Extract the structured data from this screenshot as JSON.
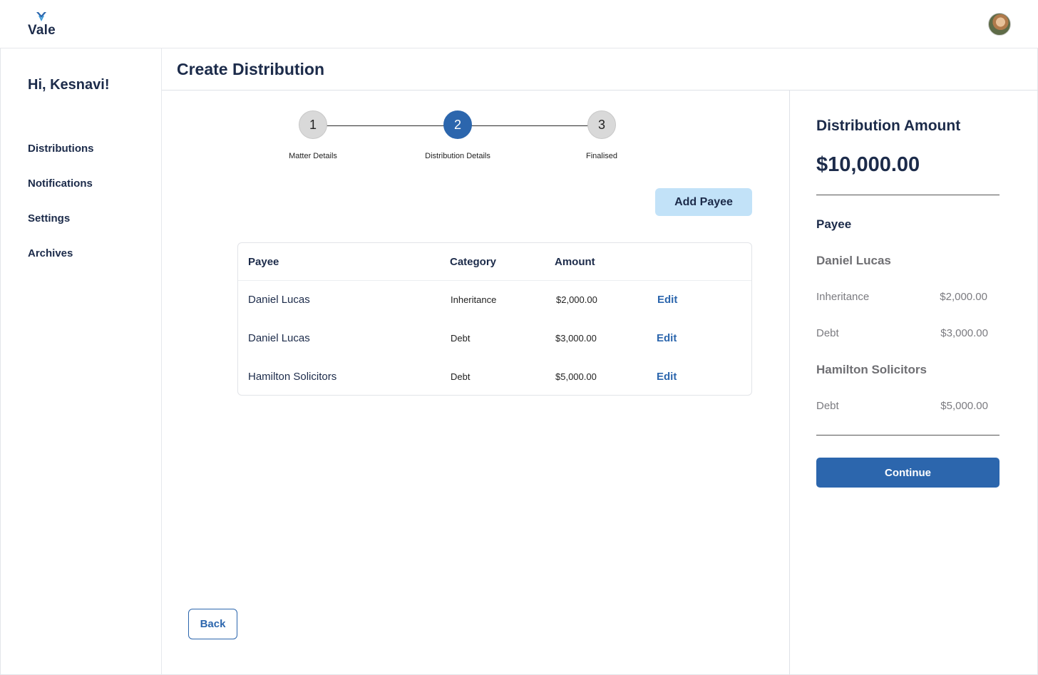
{
  "app": {
    "logo_text": "Vale"
  },
  "sidebar": {
    "greeting": "Hi, Kesnavi!",
    "items": [
      {
        "label": "Distributions"
      },
      {
        "label": "Notifications"
      },
      {
        "label": "Settings"
      },
      {
        "label": "Archives"
      }
    ]
  },
  "page": {
    "title": "Create Distribution"
  },
  "stepper": {
    "steps": [
      {
        "number": "1",
        "label": "Matter Details"
      },
      {
        "number": "2",
        "label": "Distribution Details"
      },
      {
        "number": "3",
        "label": "Finalised"
      }
    ],
    "active_step": 2
  },
  "actions": {
    "add_payee": "Add Payee",
    "back": "Back",
    "continue": "Continue"
  },
  "table": {
    "headers": {
      "payee": "Payee",
      "category": "Category",
      "amount": "Amount"
    },
    "rows": [
      {
        "payee": "Daniel Lucas",
        "category": "Inheritance",
        "amount": "$2,000.00",
        "action": "Edit"
      },
      {
        "payee": "Daniel Lucas",
        "category": "Debt",
        "amount": "$3,000.00",
        "action": "Edit"
      },
      {
        "payee": "Hamilton Solicitors",
        "category": "Debt",
        "amount": "$5,000.00",
        "action": "Edit"
      }
    ]
  },
  "summary": {
    "title": "Distribution Amount",
    "total": "$10,000.00",
    "payee_heading": "Payee",
    "groups": [
      {
        "name": "Daniel Lucas",
        "items": [
          {
            "category": "Inheritance",
            "amount": "$2,000.00"
          },
          {
            "category": "Debt",
            "amount": "$3,000.00"
          }
        ]
      },
      {
        "name": "Hamilton Solicitors",
        "items": [
          {
            "category": "Debt",
            "amount": "$5,000.00"
          }
        ]
      }
    ]
  },
  "colors": {
    "primary": "#2c66ad",
    "accent_light": "#c2e2f8",
    "text_dark": "#1c2b4a"
  }
}
